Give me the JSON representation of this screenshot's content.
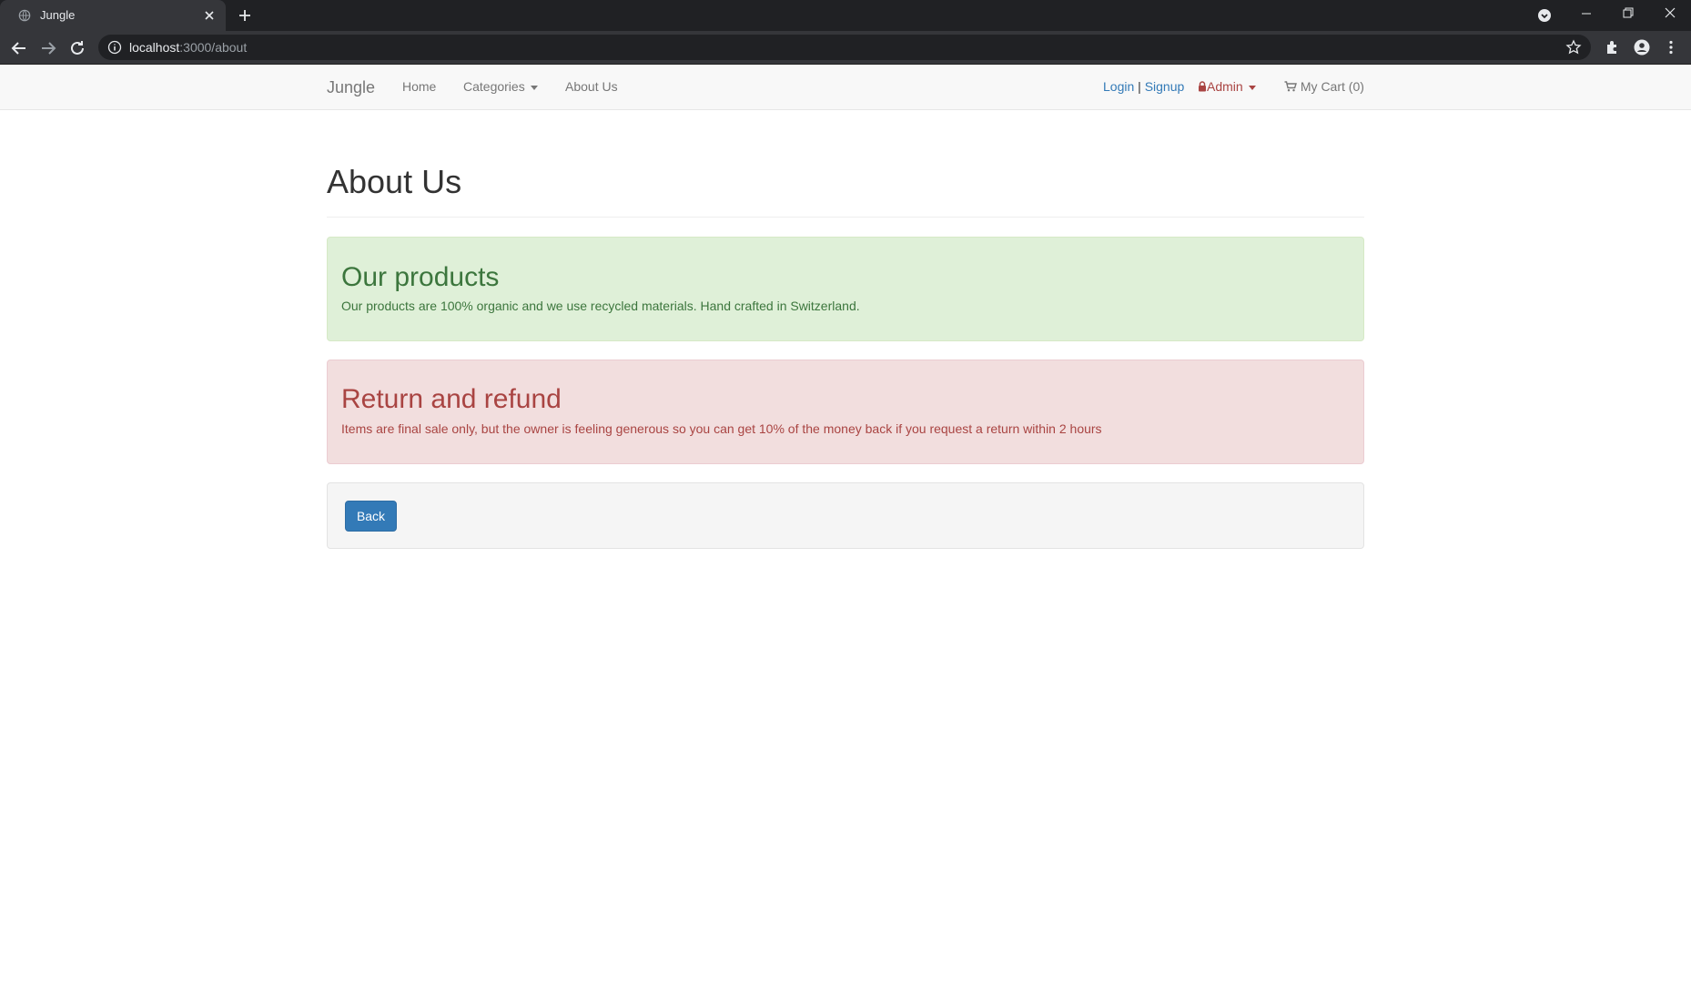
{
  "browser": {
    "tab_title": "Jungle",
    "url_host": "localhost",
    "url_path": ":3000/about"
  },
  "navbar": {
    "brand": "Jungle",
    "links": {
      "home": "Home",
      "categories": "Categories",
      "about": "About Us"
    },
    "auth": {
      "login": "Login",
      "separator": "|",
      "signup": "Signup"
    },
    "admin": "Admin",
    "cart": "My Cart (0)"
  },
  "page": {
    "title": "About Us"
  },
  "products_section": {
    "heading": "Our products",
    "text": "Our products are 100% organic and we use recycled materials. Hand crafted in Switzerland."
  },
  "refund_section": {
    "heading": "Return and refund",
    "text": "Items are final sale only, but the owner is feeling generous so you can get 10% of the money back if you request a return within 2 hours"
  },
  "actions": {
    "back_label": "Back"
  },
  "colors": {
    "success_bg": "#dff0d8",
    "success_text": "#3c763d",
    "danger_bg": "#f2dede",
    "danger_text": "#a94442",
    "primary": "#337ab7",
    "link": "#337ab7"
  },
  "icons": [
    "globe-icon",
    "close-icon",
    "plus-icon",
    "minimize-icon",
    "restore-icon",
    "back-arrow-icon",
    "forward-arrow-icon",
    "reload-icon",
    "info-icon",
    "star-icon",
    "puzzle-icon",
    "profile-icon",
    "kebab-menu-icon",
    "lock-icon",
    "cart-icon"
  ]
}
